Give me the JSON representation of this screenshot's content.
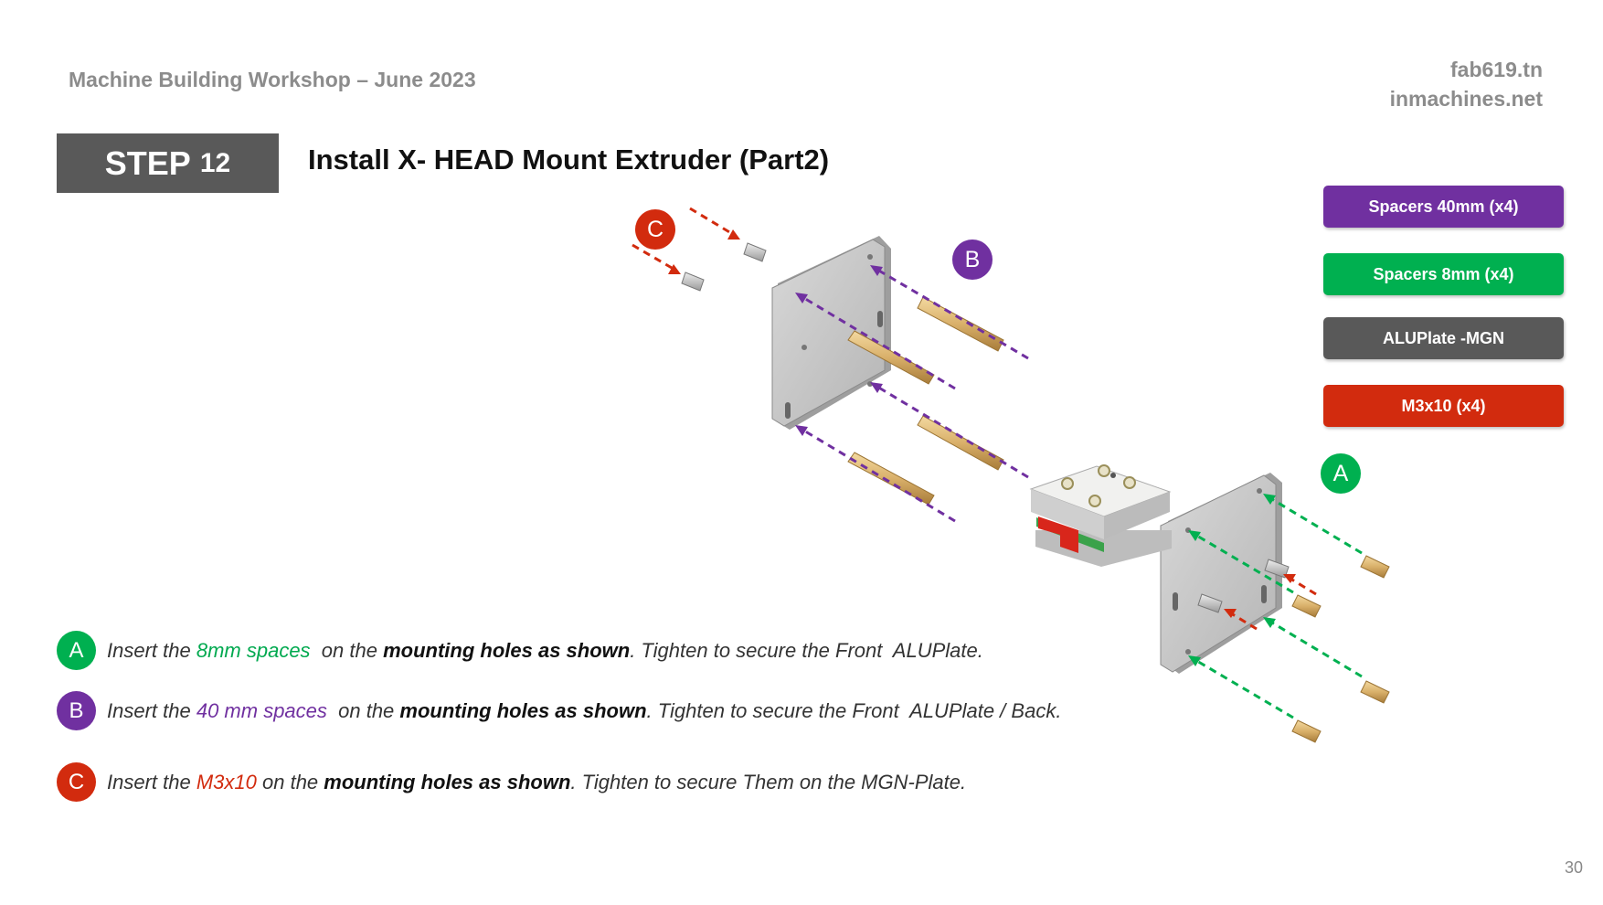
{
  "header": {
    "workshop": "Machine Building Workshop – June 2023",
    "site1": "fab619.tn",
    "site2": "inmachines.net"
  },
  "step": {
    "word": "STEP",
    "number": "12",
    "title": "Install X- HEAD Mount Extruder (Part2)"
  },
  "legend": [
    {
      "label": "Spacers 40mm (x4)",
      "color": "#7030a0"
    },
    {
      "label": "Spacers 8mm (x4)",
      "color": "#00b050"
    },
    {
      "label": "ALUPlate -MGN",
      "color": "#595959"
    },
    {
      "label": "M3x10 (x4)",
      "color": "#d22b0e"
    }
  ],
  "diagram_labels": {
    "c": "C",
    "b": "B",
    "a": "A"
  },
  "instructions": [
    {
      "badge": "A",
      "color": "#00b050",
      "t1": "Insert the ",
      "hl": "8mm spaces",
      "t2": "  on the ",
      "bold": "mounting holes as shown",
      "t3": ". Tighten to secure the Front  ALUPlate."
    },
    {
      "badge": "B",
      "color": "#7030a0",
      "t1": "Insert the ",
      "hl": "40 mm spaces",
      "t2": "  on the ",
      "bold": "mounting holes as shown",
      "t3": ". Tighten to secure the Front  ALUPlate / Back."
    },
    {
      "badge": "C",
      "color": "#d22b0e",
      "t1": "Insert the ",
      "hl": "M3x10",
      "t2": " on the ",
      "bold": "mounting holes as shown",
      "t3": ". Tighten to secure Them on the MGN-Plate."
    }
  ],
  "page_number": "30"
}
